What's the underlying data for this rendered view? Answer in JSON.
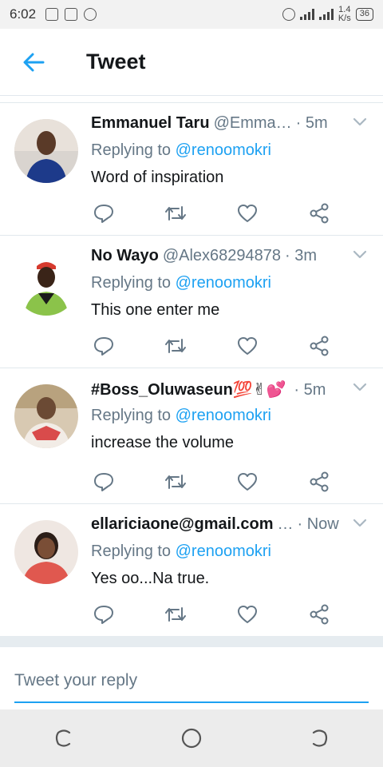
{
  "status_bar": {
    "time": "6:02",
    "net_speed_top": "1.4",
    "net_speed_bottom": "K/s",
    "battery": "36",
    "icons": [
      "image-icon",
      "battery-saver-icon",
      "whatsapp-icon",
      "data-saver-icon",
      "signal-icon"
    ]
  },
  "header": {
    "title": "Tweet",
    "back_icon": "arrow-left-icon"
  },
  "tweets": [
    {
      "name": "Emmanuel Taru",
      "handle": "@Emma…",
      "time": "· 5m",
      "replying_prefix": "Replying to",
      "replying_to": "@renoomokri",
      "text": "Word of inspiration"
    },
    {
      "name": "No Wayo",
      "handle": "@Alex68294878",
      "time": "· 3m",
      "replying_prefix": "Replying to",
      "replying_to": "@renoomokri",
      "text": "This one enter me"
    },
    {
      "name": "#Boss_Oluwaseun💯✌💕",
      "handle": "",
      "time": "· 5m",
      "replying_prefix": "Replying to",
      "replying_to": "@renoomokri",
      "text": "increase the volume"
    },
    {
      "name": "ellariciaone@gmail.com",
      "handle": "…",
      "time": "· Now",
      "replying_prefix": "Replying to",
      "replying_to": "@renoomokri",
      "text": "Yes oo...Na  true."
    }
  ],
  "actions": [
    "reply-icon",
    "retweet-icon",
    "like-icon",
    "share-icon"
  ],
  "reply_box": {
    "placeholder": "Tweet your reply"
  },
  "colors": {
    "accent": "#1da1f2",
    "secondary_text": "#657786",
    "icon_gray": "#657786",
    "divider": "#e1e8ed"
  }
}
